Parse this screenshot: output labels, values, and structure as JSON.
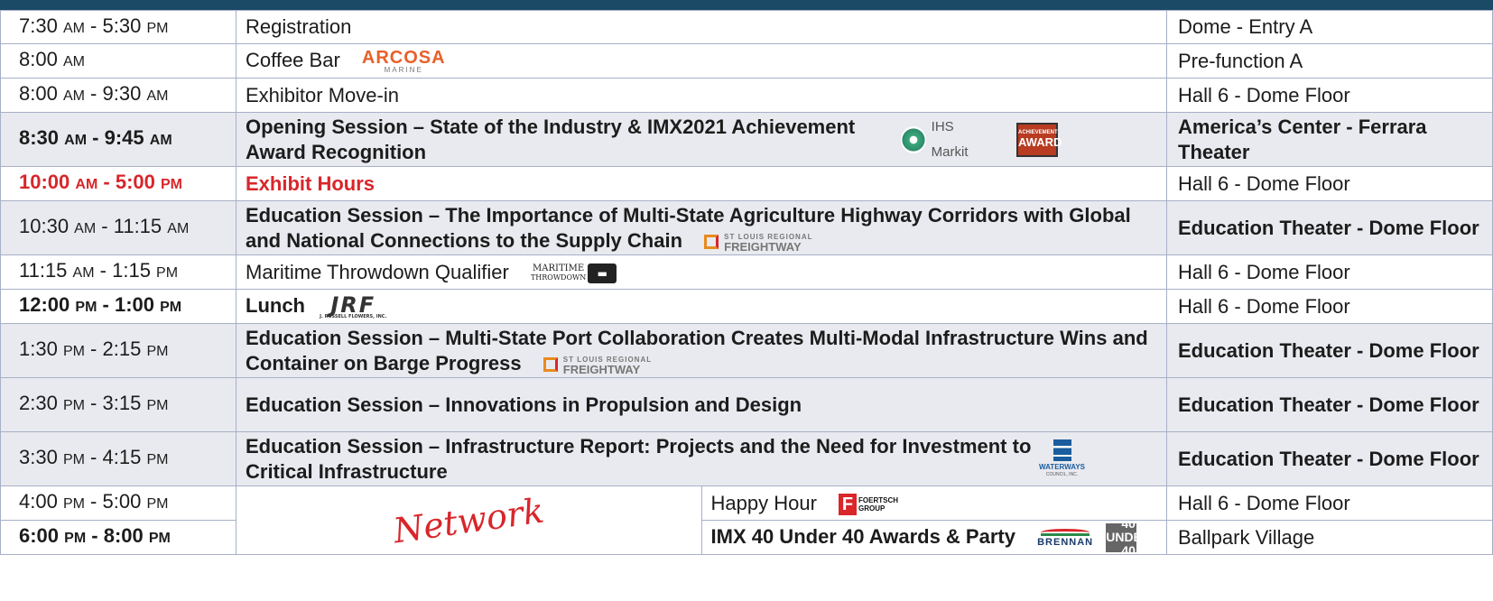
{
  "schedule": [
    {
      "time_a": "7:30 ",
      "ampm_a": "AM",
      "sep": " - ",
      "time_b": "5:30 ",
      "ampm_b": "PM",
      "event": "Registration",
      "location": "Dome - Entry A"
    },
    {
      "time_a": "8:00 ",
      "ampm_a": "AM",
      "event": "Coffee Bar",
      "location": "Pre-function A",
      "logo": {
        "name": "ARCOSA",
        "sub": "MARINE"
      }
    },
    {
      "time_a": "8:00 ",
      "ampm_a": "AM",
      "sep": " - ",
      "time_b": "9:30 ",
      "ampm_b": "AM",
      "event": "Exhibitor Move-in",
      "location": "Hall 6 - Dome Floor"
    },
    {
      "time_a": "8:30 ",
      "ampm_a": "AM",
      "sep": " - ",
      "time_b": "9:45 ",
      "ampm_b": "AM",
      "event": "Opening Session – State of the Industry & IMX2021 Achievement Award Recognition",
      "location": "America’s Center - Ferrara Theater",
      "logo_ihs": "IHS Markit",
      "award_top": "ACHIEVEMENT",
      "award_main": "AWARD"
    },
    {
      "time_a": "10:00 ",
      "ampm_a": "AM",
      "sep": " - ",
      "time_b": "5:00 ",
      "ampm_b": "PM",
      "event": "Exhibit Hours",
      "location": "Hall 6 - Dome Floor"
    },
    {
      "time_a": "10:30 ",
      "ampm_a": "AM",
      "sep": " - ",
      "time_b": "11:15 ",
      "ampm_b": "AM",
      "event": "Education Session – The Importance of Multi-State Agriculture Highway Corridors with Global and National Connections to the Supply Chain",
      "location": "Education Theater - Dome Floor"
    },
    {
      "time_a": "11:15 ",
      "ampm_a": "AM",
      "sep": " - ",
      "time_b": "1:15 ",
      "ampm_b": "PM",
      "event": "Maritime Throwdown Qualifier",
      "location": "Hall 6 - Dome Floor",
      "logo": {
        "top": "MARITIME",
        "bottom": "THROWDOWN"
      }
    },
    {
      "time_a": "12:00 ",
      "ampm_a": "PM",
      "sep": " - ",
      "time_b": "1:00 ",
      "ampm_b": "PM",
      "event": "Lunch",
      "location": "Hall 6 - Dome Floor",
      "logo": {
        "name": "JRF",
        "sub": "J. RUSSELL FLOWERS, INC."
      }
    },
    {
      "time_a": "1:30 ",
      "ampm_a": "PM",
      "sep": " - ",
      "time_b": "2:15 ",
      "ampm_b": "PM",
      "event": "Education Session – Multi-State Port Collaboration Creates Multi-Modal Infrastructure Wins and Container on Barge Progress",
      "location": "Education Theater - Dome Floor"
    },
    {
      "time_a": "2:30 ",
      "ampm_a": "PM",
      "sep": " - ",
      "time_b": "3:15 ",
      "ampm_b": "PM",
      "event": "Education Session – Innovations in Propulsion and Design",
      "location": "Education Theater - Dome Floor"
    },
    {
      "time_a": "3:30 ",
      "ampm_a": "PM",
      "sep": " - ",
      "time_b": "4:15 ",
      "ampm_b": "PM",
      "event": "Education Session – Infrastructure Report: Projects and the Need for Investment to Critical Infrastructure",
      "location": "Education Theater - Dome Floor",
      "logo": {
        "name": "WATERWAYS",
        "sub": "COUNCIL, INC."
      }
    },
    {
      "time_a": "4:00 ",
      "ampm_a": "PM",
      "sep": " - ",
      "time_b": "5:00 ",
      "ampm_b": "PM",
      "event": "Happy Hour",
      "location": "Hall 6 - Dome Floor",
      "logo": {
        "mark": "F",
        "top": "FOERTSCH",
        "bottom": "GROUP"
      }
    },
    {
      "time_a": "6:00 ",
      "ampm_a": "PM",
      "sep": " - ",
      "time_b": "8:00 ",
      "ampm_b": "PM",
      "event": "IMX 40 Under 40 Awards & Party",
      "location": "Ballpark Village",
      "logo": {
        "name": "BRENNAN"
      },
      "badge": "40 UNDER 40"
    }
  ],
  "freightway": {
    "small": "ST LOUIS REGIONAL",
    "big": "FREIGHTWAY"
  },
  "network_label": "Network",
  "colors": {
    "header": "#1b4a66",
    "highlight": "#d8262a",
    "shaded": "#e9eaef",
    "border": "#a8b0c8"
  }
}
